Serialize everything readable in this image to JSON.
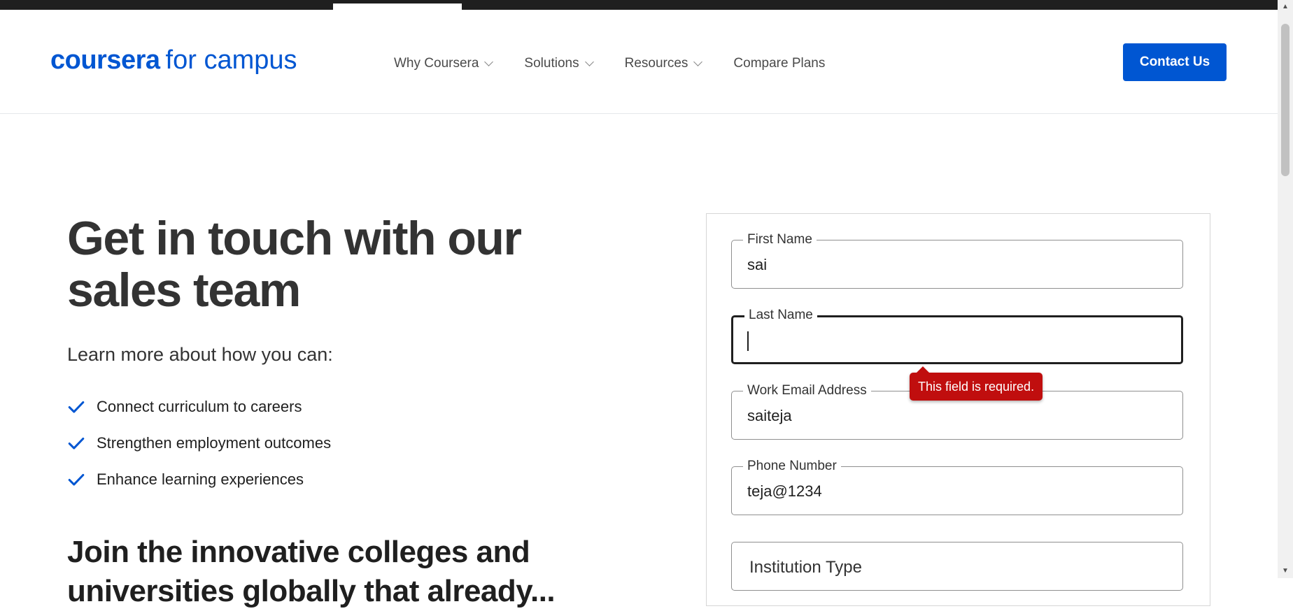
{
  "header": {
    "logo_brand": "coursera",
    "logo_sub": "for campus",
    "nav": [
      {
        "label": "Why Coursera",
        "has_dropdown": true
      },
      {
        "label": "Solutions",
        "has_dropdown": true
      },
      {
        "label": "Resources",
        "has_dropdown": true
      },
      {
        "label": "Compare Plans",
        "has_dropdown": false
      }
    ],
    "contact_label": "Contact Us"
  },
  "hero": {
    "headline": "Get in touch with our sales team",
    "lead": "Learn more about how you can:",
    "bullets": [
      "Connect curriculum to careers",
      "Strengthen employment outcomes",
      "Enhance learning experiences"
    ],
    "sub_headline": "Join the innovative colleges and universities globally that already..."
  },
  "form": {
    "fields": [
      {
        "label": "First Name",
        "value": "sai"
      },
      {
        "label": "Last Name",
        "value": ""
      },
      {
        "label": "Work Email Address",
        "value": "saiteja"
      },
      {
        "label": "Phone Number",
        "value": "teja@1234"
      }
    ],
    "institution_type_label": "Institution Type",
    "error_tooltip": "This field is required."
  },
  "colors": {
    "brand_blue": "#0056d2",
    "error_red": "#c00e0e",
    "text_dark": "#333333"
  },
  "icons": {
    "check": "check-icon",
    "chevron": "chevron-down-icon"
  }
}
